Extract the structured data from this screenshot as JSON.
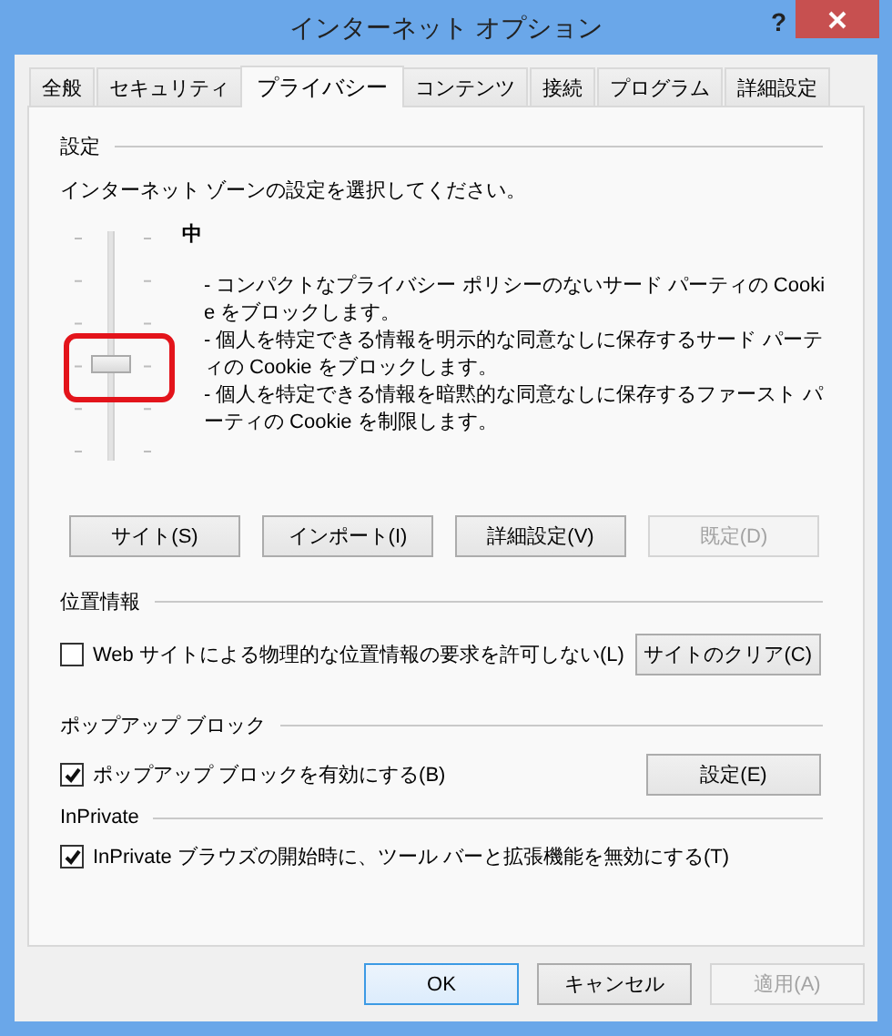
{
  "window": {
    "title": "インターネット オプション",
    "help": "?"
  },
  "tabs": [
    {
      "label": "全般",
      "selected": false
    },
    {
      "label": "セキュリティ",
      "selected": false
    },
    {
      "label": "プライバシー",
      "selected": true
    },
    {
      "label": "コンテンツ",
      "selected": false
    },
    {
      "label": "接続",
      "selected": false
    },
    {
      "label": "プログラム",
      "selected": false
    },
    {
      "label": "詳細設定",
      "selected": false
    }
  ],
  "privacy": {
    "heading": "設定",
    "instruction": "インターネット ゾーンの設定を選択してください。",
    "slider": {
      "level": 0.4,
      "highlighted": true
    },
    "level_name": "中",
    "description": [
      "- コンパクトなプライバシー ポリシーのないサード パーティの Cookie をブロックします。",
      "- 個人を特定できる情報を明示的な同意なしに保存するサード パーティの Cookie をブロックします。",
      "- 個人を特定できる情報を暗黙的な同意なしに保存するファースト パーティの Cookie を制限します。"
    ],
    "buttons": [
      {
        "label": "サイト(S)",
        "disabled": false
      },
      {
        "label": "インポート(I)",
        "disabled": false
      },
      {
        "label": "詳細設定(V)",
        "disabled": false
      },
      {
        "label": "既定(D)",
        "disabled": true
      }
    ]
  },
  "location": {
    "heading": "位置情報",
    "checkbox": {
      "label": "Web サイトによる物理的な位置情報の要求を許可しない(L)",
      "checked": false
    },
    "button": {
      "label": "サイトのクリア(C)",
      "disabled": false
    }
  },
  "popup": {
    "heading": "ポップアップ ブロック",
    "checkbox": {
      "label": "ポップアップ ブロックを有効にする(B)",
      "checked": true
    },
    "button": {
      "label": "設定(E)",
      "disabled": false
    }
  },
  "inprivate": {
    "heading": "InPrivate",
    "checkbox": {
      "label": "InPrivate ブラウズの開始時に、ツール バーと拡張機能を無効にする(T)",
      "checked": true
    }
  },
  "footer_buttons": [
    {
      "label": "OK",
      "focused": true,
      "disabled": false
    },
    {
      "label": "キャンセル",
      "focused": false,
      "disabled": false
    },
    {
      "label": "適用(A)",
      "focused": false,
      "disabled": true
    }
  ]
}
